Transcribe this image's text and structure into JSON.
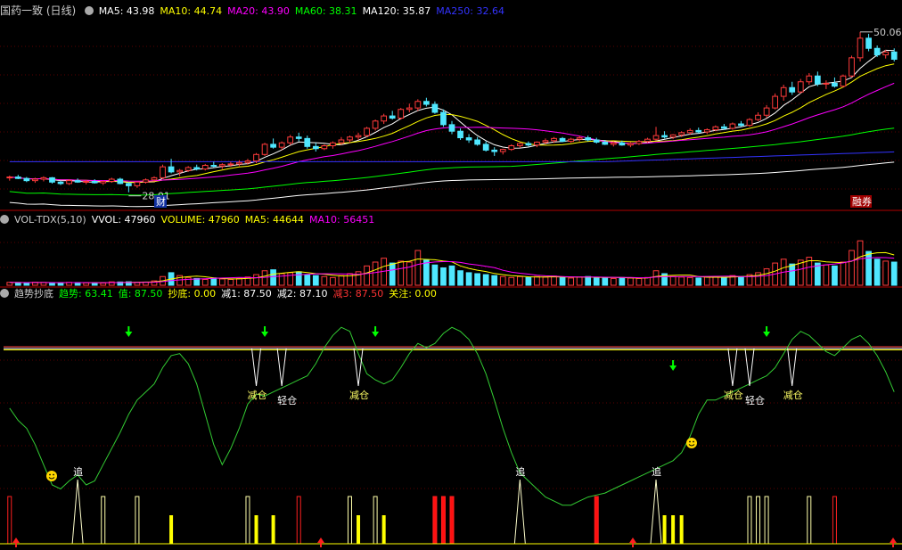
{
  "price_panel": {
    "stock_title": "国药一致 (日线)",
    "ma_items": [
      {
        "text": "MA5: 43.98",
        "color": "#ffffff"
      },
      {
        "text": "MA10: 44.74",
        "color": "#ffff00"
      },
      {
        "text": "MA20: 43.90",
        "color": "#ff00ff"
      },
      {
        "text": "MA60: 38.31",
        "color": "#00ff00"
      },
      {
        "text": "MA120: 35.87",
        "color": "#ffffff"
      },
      {
        "text": "MA250: 32.64",
        "color": "#3333ff"
      }
    ],
    "high_label": "50.06",
    "low_label": "28.01",
    "markers": [
      "财",
      "融券"
    ]
  },
  "volume_panel": {
    "title": "VOL-TDX(5,10)",
    "items": [
      {
        "text": "VVOL: 47960",
        "color": "#ffffff"
      },
      {
        "text": "VOLUME: 47960",
        "color": "#ffff00"
      },
      {
        "text": "MA5: 44644",
        "color": "#ffff00"
      },
      {
        "text": "MA10: 56451",
        "color": "#ff00ff"
      }
    ]
  },
  "indicator_panel": {
    "title": "趋势抄底",
    "items": [
      {
        "text": "趋势: 63.41",
        "color": "#00ff00"
      },
      {
        "text": "值: 87.50",
        "color": "#00ff00"
      },
      {
        "text": "抄底: 0.00",
        "color": "#ffff00"
      },
      {
        "text": "减1: 87.50",
        "color": "#ffffff"
      },
      {
        "text": "减2: 87.10",
        "color": "#ffffff"
      },
      {
        "text": "减3: 87.50",
        "color": "#ff3333"
      },
      {
        "text": "关注: 0.00",
        "color": "#ffff00"
      }
    ],
    "annotations": {
      "reduce": "减仓",
      "light": "轻仓",
      "chase": "追"
    }
  },
  "chart_data": {
    "type": "candlestick",
    "price": {
      "ylim": [
        26,
        52
      ],
      "candles": [
        [
          30.0,
          30.3,
          29.6,
          30.1
        ],
        [
          30.1,
          30.4,
          29.8,
          29.9
        ],
        [
          29.9,
          30.1,
          29.4,
          29.6
        ],
        [
          29.6,
          30.0,
          29.3,
          29.8
        ],
        [
          29.8,
          30.2,
          29.5,
          30.0
        ],
        [
          30.0,
          30.1,
          29.2,
          29.4
        ],
        [
          29.4,
          29.6,
          29.0,
          29.2
        ],
        [
          29.2,
          29.8,
          29.0,
          29.6
        ],
        [
          29.6,
          29.9,
          29.3,
          29.4
        ],
        [
          29.4,
          29.7,
          29.1,
          29.5
        ],
        [
          29.5,
          29.8,
          29.2,
          29.3
        ],
        [
          29.3,
          29.6,
          29.0,
          29.5
        ],
        [
          29.5,
          30.0,
          29.3,
          29.8
        ],
        [
          29.8,
          30.0,
          29.1,
          29.2
        ],
        [
          29.2,
          29.4,
          28.0,
          28.9
        ],
        [
          28.9,
          29.5,
          28.6,
          29.4
        ],
        [
          29.4,
          29.9,
          29.2,
          29.7
        ],
        [
          29.7,
          30.2,
          29.5,
          30.0
        ],
        [
          30.0,
          31.8,
          29.8,
          31.5
        ],
        [
          31.5,
          32.6,
          30.6,
          30.8
        ],
        [
          30.8,
          31.2,
          30.2,
          31.0
        ],
        [
          31.0,
          31.6,
          30.8,
          31.4
        ],
        [
          31.4,
          31.8,
          31.0,
          31.2
        ],
        [
          31.2,
          31.9,
          31.0,
          31.7
        ],
        [
          31.7,
          32.2,
          31.4,
          31.6
        ],
        [
          31.6,
          32.0,
          31.2,
          31.8
        ],
        [
          31.8,
          32.2,
          31.5,
          31.9
        ],
        [
          31.9,
          32.4,
          31.6,
          32.1
        ],
        [
          32.1,
          32.6,
          31.8,
          32.3
        ],
        [
          32.3,
          33.4,
          32.0,
          33.2
        ],
        [
          33.2,
          34.8,
          33.0,
          34.6
        ],
        [
          34.6,
          35.4,
          34.0,
          34.2
        ],
        [
          34.2,
          35.0,
          33.8,
          34.8
        ],
        [
          34.8,
          35.9,
          34.5,
          35.6
        ],
        [
          35.6,
          36.2,
          35.0,
          35.4
        ],
        [
          35.4,
          35.8,
          34.0,
          34.3
        ],
        [
          34.3,
          34.8,
          33.6,
          34.0
        ],
        [
          34.0,
          34.6,
          33.8,
          34.4
        ],
        [
          34.4,
          35.0,
          34.0,
          34.8
        ],
        [
          34.8,
          35.6,
          34.5,
          35.2
        ],
        [
          35.2,
          35.8,
          34.8,
          35.6
        ],
        [
          35.6,
          36.2,
          35.2,
          35.8
        ],
        [
          35.8,
          37.0,
          35.6,
          36.8
        ],
        [
          36.8,
          38.0,
          36.5,
          37.8
        ],
        [
          37.8,
          38.8,
          37.4,
          38.5
        ],
        [
          38.5,
          39.2,
          38.0,
          38.2
        ],
        [
          38.2,
          39.6,
          38.0,
          39.4
        ],
        [
          39.4,
          40.2,
          39.0,
          39.6
        ],
        [
          39.6,
          40.8,
          39.2,
          40.5
        ],
        [
          40.5,
          41.0,
          39.8,
          40.1
        ],
        [
          40.1,
          40.5,
          38.8,
          39.0
        ],
        [
          39.0,
          39.4,
          37.0,
          37.3
        ],
        [
          37.3,
          37.8,
          36.0,
          36.4
        ],
        [
          36.4,
          36.8,
          35.2,
          35.5
        ],
        [
          35.5,
          36.0,
          34.8,
          35.2
        ],
        [
          35.2,
          35.6,
          34.4,
          34.6
        ],
        [
          34.6,
          35.0,
          33.6,
          33.8
        ],
        [
          33.8,
          34.2,
          33.0,
          33.6
        ],
        [
          33.6,
          34.0,
          33.2,
          33.9
        ],
        [
          33.9,
          34.6,
          33.7,
          34.4
        ],
        [
          34.4,
          34.9,
          34.1,
          34.7
        ],
        [
          34.7,
          35.0,
          34.3,
          34.5
        ],
        [
          34.5,
          35.0,
          34.2,
          34.9
        ],
        [
          34.9,
          35.4,
          34.6,
          35.1
        ],
        [
          35.1,
          35.6,
          34.8,
          35.4
        ],
        [
          35.4,
          35.6,
          34.9,
          35.0
        ],
        [
          35.0,
          35.5,
          34.8,
          35.3
        ],
        [
          35.3,
          35.8,
          35.0,
          35.5
        ],
        [
          35.5,
          35.8,
          35.0,
          35.2
        ],
        [
          35.2,
          35.5,
          34.7,
          34.9
        ],
        [
          34.9,
          35.2,
          34.5,
          34.6
        ],
        [
          34.6,
          35.0,
          34.3,
          34.8
        ],
        [
          34.8,
          35.1,
          34.4,
          34.5
        ],
        [
          34.5,
          34.9,
          34.2,
          34.7
        ],
        [
          34.7,
          35.2,
          34.5,
          35.0
        ],
        [
          35.0,
          35.5,
          34.8,
          35.3
        ],
        [
          35.3,
          37.0,
          35.1,
          35.8
        ],
        [
          35.8,
          36.4,
          35.4,
          35.6
        ],
        [
          35.6,
          36.0,
          35.3,
          35.9
        ],
        [
          35.9,
          36.4,
          35.6,
          36.2
        ],
        [
          36.2,
          36.8,
          35.9,
          36.5
        ],
        [
          36.5,
          36.9,
          36.1,
          36.3
        ],
        [
          36.3,
          36.8,
          36.0,
          36.6
        ],
        [
          36.6,
          37.2,
          36.4,
          37.0
        ],
        [
          37.0,
          37.4,
          36.6,
          36.8
        ],
        [
          36.8,
          37.6,
          36.6,
          37.4
        ],
        [
          37.4,
          37.8,
          37.0,
          37.2
        ],
        [
          37.2,
          38.2,
          37.0,
          38.0
        ],
        [
          38.0,
          39.0,
          37.8,
          38.6
        ],
        [
          38.6,
          40.0,
          38.2,
          39.6
        ],
        [
          39.6,
          41.6,
          39.4,
          41.2
        ],
        [
          41.2,
          42.8,
          40.6,
          42.4
        ],
        [
          42.4,
          43.2,
          41.4,
          41.8
        ],
        [
          41.8,
          43.6,
          41.6,
          43.2
        ],
        [
          43.2,
          44.4,
          42.8,
          44.0
        ],
        [
          44.0,
          44.6,
          42.6,
          42.9
        ],
        [
          42.9,
          43.4,
          42.2,
          43.0
        ],
        [
          43.0,
          43.8,
          42.4,
          42.6
        ],
        [
          42.6,
          44.2,
          42.4,
          44.0
        ],
        [
          44.0,
          46.8,
          43.8,
          46.5
        ],
        [
          46.5,
          50.06,
          46.0,
          49.2
        ],
        [
          49.2,
          49.8,
          47.4,
          47.8
        ],
        [
          47.8,
          48.2,
          46.6,
          46.9
        ],
        [
          46.9,
          47.6,
          46.4,
          47.3
        ],
        [
          47.3,
          47.8,
          46.0,
          46.3
        ]
      ]
    },
    "volume": {
      "ylim": [
        0,
        120000
      ],
      "values": [
        6000,
        5500,
        5000,
        6200,
        5800,
        5200,
        4800,
        6000,
        5600,
        5000,
        5200,
        4600,
        7000,
        6800,
        7200,
        5600,
        6400,
        9000,
        18000,
        26000,
        20000,
        16000,
        14000,
        12000,
        15000,
        13000,
        12000,
        14000,
        17000,
        22000,
        30000,
        32000,
        24000,
        26000,
        28000,
        22000,
        20000,
        18000,
        16000,
        20000,
        24000,
        28000,
        40000,
        48000,
        56000,
        46000,
        50000,
        48000,
        72000,
        52000,
        42000,
        36000,
        40000,
        30000,
        26000,
        24000,
        22000,
        20000,
        18000,
        16000,
        18000,
        16000,
        18000,
        17000,
        19000,
        16000,
        15000,
        17000,
        18000,
        16000,
        15000,
        14000,
        16000,
        15000,
        14000,
        16000,
        30000,
        24000,
        18000,
        17000,
        16000,
        15000,
        17000,
        18000,
        16000,
        20000,
        18000,
        22000,
        26000,
        34000,
        46000,
        54000,
        44000,
        52000,
        58000,
        46000,
        42000,
        40000,
        48000,
        72000,
        92000,
        70000,
        54000,
        50000,
        47960
      ]
    },
    "indicator": {
      "ylim": [
        -10,
        110
      ],
      "reference_level": 87.5,
      "trend": [
        58,
        52,
        48,
        40,
        30,
        20,
        18,
        22,
        25,
        20,
        22,
        30,
        38,
        46,
        55,
        62,
        66,
        70,
        78,
        84,
        85,
        80,
        70,
        55,
        40,
        30,
        38,
        48,
        60,
        65,
        64,
        66,
        68,
        70,
        72,
        74,
        80,
        88,
        94,
        98,
        96,
        85,
        75,
        72,
        70,
        72,
        78,
        85,
        90,
        88,
        90,
        95,
        98,
        96,
        92,
        85,
        75,
        62,
        48,
        36,
        26,
        22,
        18,
        14,
        12,
        10,
        10,
        12,
        14,
        15,
        16,
        18,
        20,
        22,
        24,
        26,
        28,
        30,
        32,
        36,
        44,
        55,
        62,
        62,
        64,
        66,
        68,
        70,
        72,
        74,
        78,
        85,
        92,
        96,
        94,
        90,
        86,
        84,
        88,
        92,
        94,
        90,
        84,
        76,
        66
      ]
    }
  }
}
